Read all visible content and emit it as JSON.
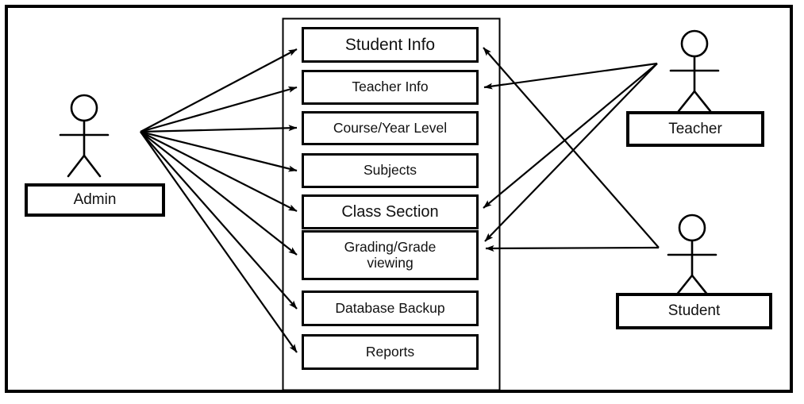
{
  "diagram": {
    "type": "uml-use-case-diagram",
    "title": "",
    "system_boundary": {
      "label": ""
    },
    "colors": {
      "stroke": "#000000",
      "fill": "#ffffff",
      "text": "#111111"
    },
    "actors": [
      {
        "id": "admin",
        "label": "Admin"
      },
      {
        "id": "teacher",
        "label": "Teacher"
      },
      {
        "id": "student",
        "label": "Student"
      }
    ],
    "use_cases": [
      {
        "id": "student_info",
        "label": "Student Info"
      },
      {
        "id": "teacher_info",
        "label": "Teacher  Info"
      },
      {
        "id": "course_year",
        "label": "Course/Year  Level"
      },
      {
        "id": "subjects",
        "label": "Subjects"
      },
      {
        "id": "class_section",
        "label": "Class Section"
      },
      {
        "id": "grading",
        "label": "Grading/Grade",
        "label_line2": "viewing"
      },
      {
        "id": "db_backup",
        "label": "Database  Backup"
      },
      {
        "id": "reports",
        "label": "Reports"
      }
    ],
    "associations": [
      {
        "from": "admin",
        "to": "student_info"
      },
      {
        "from": "admin",
        "to": "teacher_info"
      },
      {
        "from": "admin",
        "to": "course_year"
      },
      {
        "from": "admin",
        "to": "subjects"
      },
      {
        "from": "admin",
        "to": "class_section"
      },
      {
        "from": "admin",
        "to": "grading"
      },
      {
        "from": "admin",
        "to": "db_backup"
      },
      {
        "from": "admin",
        "to": "reports"
      },
      {
        "from": "teacher",
        "to": "student_info"
      },
      {
        "from": "teacher",
        "to": "teacher_info"
      },
      {
        "from": "teacher",
        "to": "grading"
      },
      {
        "from": "student",
        "to": "class_section"
      },
      {
        "from": "student",
        "to": "grading"
      }
    ]
  }
}
